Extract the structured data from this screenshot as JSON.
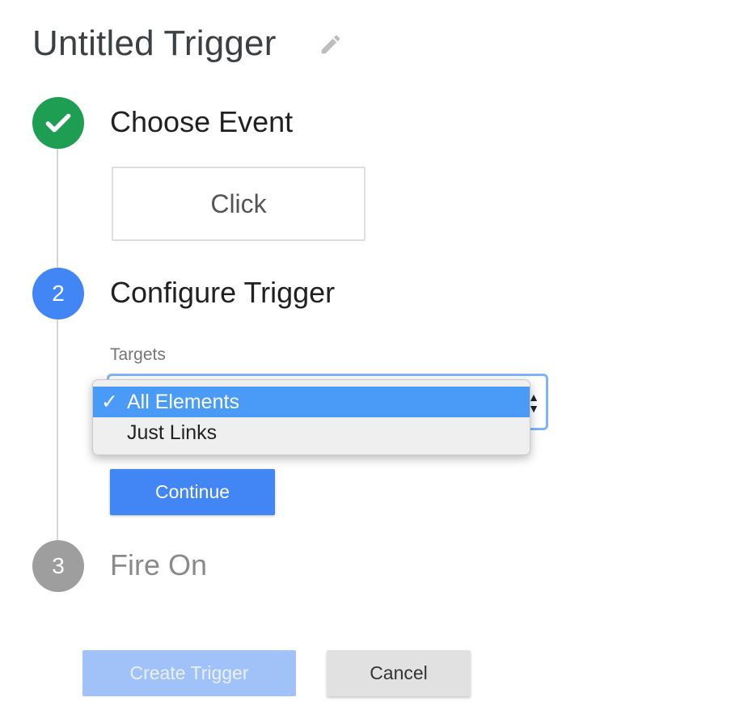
{
  "header": {
    "title": "Untitled Trigger",
    "edit_icon": "pencil-icon"
  },
  "steps": [
    {
      "marker": "check",
      "label": "Choose Event",
      "state": "done",
      "color": "#1e9e53"
    },
    {
      "marker": "2",
      "label": "Configure Trigger",
      "state": "active",
      "color": "#4285f4"
    },
    {
      "marker": "3",
      "label": "Fire On",
      "state": "pending",
      "color": "#9e9e9e"
    }
  ],
  "event": {
    "selected": "Click"
  },
  "configure": {
    "targets_label": "Targets",
    "options": [
      {
        "label": "All Elements",
        "checked": true
      },
      {
        "label": "Just Links",
        "checked": false
      }
    ],
    "continue_label": "Continue"
  },
  "footer": {
    "create_label": "Create Trigger",
    "cancel_label": "Cancel"
  },
  "colors": {
    "accent": "#4285f4",
    "success": "#1e9e53",
    "selection": "#4a9af8"
  }
}
